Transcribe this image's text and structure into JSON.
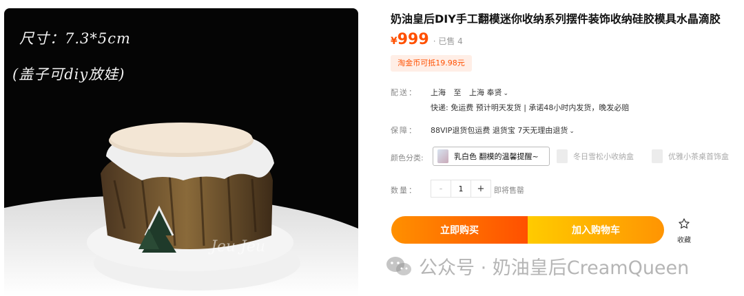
{
  "product": {
    "title": "奶油皇后DIY手工翻模迷你收纳系列摆件装饰收纳硅胶模具水晶滴胶",
    "price_symbol": "¥",
    "price": "999",
    "sold": "· 已售 4",
    "coupon": "淘金币可抵19.98元"
  },
  "image": {
    "size_note": "尺寸：7.3*5cm",
    "lid_note": "(盖子可diy放娃)",
    "signature": "Jeu Jeu"
  },
  "shipping": {
    "label": "配送：",
    "from": "上海",
    "to_word": "至",
    "to": "上海 奉贤",
    "detail": "快递: 免运费  预计明天发货 | 承诺48小时内发货，晚发必赔"
  },
  "guarantee": {
    "label": "保障：",
    "value": "88VIP退货包运费 退货宝 7天无理由退货"
  },
  "color": {
    "label": "颜色分类:",
    "options": [
      {
        "label": "乳白色 翻模的温馨提醒~",
        "selected": true
      },
      {
        "label": "冬日雪松小收纳盒",
        "selected": false
      },
      {
        "label": "优雅小茶桌首饰盒",
        "selected": false
      }
    ]
  },
  "quantity": {
    "label": "数量：",
    "minus": "-",
    "value": "1",
    "plus": "+",
    "note": "即将售罄"
  },
  "actions": {
    "buy": "立即购买",
    "cart": "加入购物车",
    "favorite": "收藏"
  },
  "watermark": {
    "text": "公众号 · 奶油皇后CreamQueen"
  },
  "colors": {
    "accent": "#ff5000",
    "buy_gradient": [
      "#ff9000",
      "#ff5000"
    ],
    "cart_gradient": [
      "#ffcb00",
      "#ff9402"
    ]
  }
}
